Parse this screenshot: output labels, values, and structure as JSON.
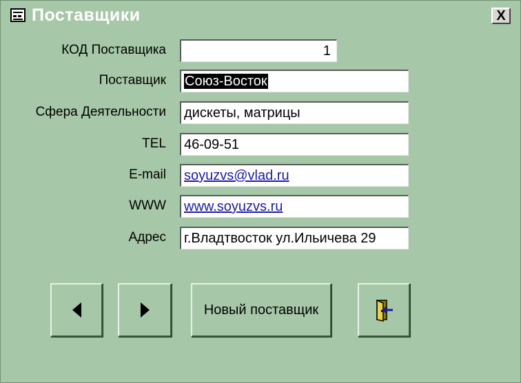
{
  "window": {
    "title": "Поставщики",
    "close_symbol": "X"
  },
  "form": {
    "fields": [
      {
        "label": "КОД Поставщика",
        "value": "1"
      },
      {
        "label": "Поставщик",
        "value": "Союз-Восток",
        "selected": true
      },
      {
        "label": "Сфера Деятельности",
        "value": "дискеты, матрицы"
      },
      {
        "label": "TEL",
        "value": "46-09-51"
      },
      {
        "label": "E-mail",
        "value": "soyuzvs@vlad.ru",
        "link": true
      },
      {
        "label": "WWW",
        "value": "www.soyuzvs.ru",
        "link": true
      },
      {
        "label": "Адрес",
        "value": "г.Владтвосток ул.Ильичева  29"
      }
    ]
  },
  "buttons": {
    "prev_icon": "arrow-left-icon",
    "next_icon": "arrow-right-icon",
    "new_supplier_label": "Новый поставщик",
    "exit_icon": "door-exit-icon"
  },
  "colors": {
    "background": "#a6c8a8",
    "link": "#1a1aa8",
    "selection": "#000000"
  }
}
